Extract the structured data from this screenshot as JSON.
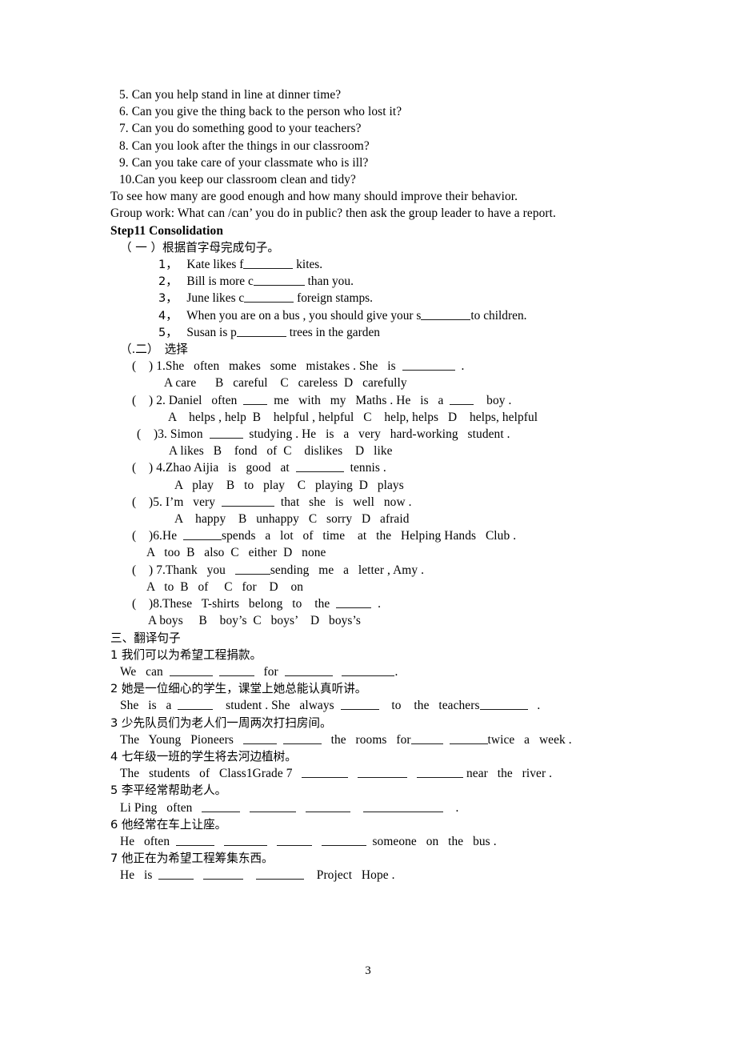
{
  "document": {
    "page_number": "3",
    "ink_color": "#000000"
  },
  "questions_can_you": [
    "5. Can you help stand in line at dinner time?",
    "6. Can you give the thing back to the person who lost it?",
    "7. Can you do something good to your teachers?",
    "8. Can you look after the things in our classroom?",
    "9. Can you take care of your classmate who is ill?",
    "10.Can you keep our classroom clean and tidy?"
  ],
  "instructions": {
    "to_see": "To see how many are good enough and how many should improve their behavior.",
    "group_work": "Group work: What can /can’ you do in public? then ask the group leader to have a report."
  },
  "step11": {
    "heading": "Step11 Consolidation",
    "section_one": {
      "label": "（ 一 ）根据首字母完成句子。",
      "items": [
        {
          "num": "1，",
          "before": "Kate likes f",
          "blank": 62,
          "after": " kites."
        },
        {
          "num": "2，",
          "before": "Bill is more c",
          "blank": 64,
          "after": " than you."
        },
        {
          "num": "3，",
          "before": "June likes c",
          "blank": 62,
          "after": " foreign stamps."
        },
        {
          "num": "4，",
          "before": "When you are on a bus , you should give your s",
          "blank": 62,
          "after": "to children."
        },
        {
          "num": "5，",
          "before": "Susan is p",
          "blank": 62,
          "after": " trees in the garden"
        }
      ]
    },
    "section_two": {
      "label": "（.二）　选择",
      "items": [
        {
          "stem_parts": [
            "(    ) 1.She   often   makes   some   mistakes . She   is  ",
            "  ."
          ],
          "blank": 66,
          "options": "A care      B   careful    C   careless  D   carefully"
        },
        {
          "stem_parts": [
            "(    ) 2. Daniel   often  ",
            "  me   with   my   Maths . He   is   a  ",
            "    boy ."
          ],
          "blank": 30,
          "blank2": 30,
          "options": "A    helps , help  B    helpful , helpful   C    help, helps   D    helps, helpful"
        },
        {
          "stem_parts": [
            "(    )3. Simon  ",
            "  studying . He   is   a   very   hard-working   student ."
          ],
          "blank": 42,
          "options": "A likes   B    fond   of  C    dislikes    D   like"
        },
        {
          "stem_parts": [
            "(    ) 4.Zhao Aijia   is   good   at  ",
            "  tennis ."
          ],
          "blank": 60,
          "options": "A   play    B   to   play    C   playing  D   plays"
        },
        {
          "stem_parts": [
            "(    )5. I’m   very  ",
            "  that   she   is   well   now ."
          ],
          "blank": 66,
          "options": "A    happy    B   unhappy   C   sorry   D   afraid"
        },
        {
          "stem_parts": [
            "(    )6.He  ",
            "spends   a   lot   of   time    at   the   Helping Hands   Club ."
          ],
          "blank": 48,
          "options": "A   too  B   also  C   either  D   none"
        },
        {
          "stem_parts": [
            "(    ) 7.Thank   you   ",
            "sending   me   a   letter , Amy ."
          ],
          "blank": 44,
          "options": "A   to  B   of     C   for    D    on"
        },
        {
          "stem_parts": [
            "(    )8.These   T-shirts   belong   to    the  ",
            "  ."
          ],
          "blank": 44,
          "options": "A boys     B    boy’s  C   boys’    D   boys’s"
        }
      ]
    }
  },
  "translation": {
    "heading": "三、翻译句子",
    "items": [
      {
        "cn": "1 我们可以为希望工程捐款。",
        "en_parts": [
          "We   can  ",
          "  ",
          "   for  ",
          "   ",
          "."
        ],
        "blanks": [
          54,
          44,
          60,
          66
        ]
      },
      {
        "cn": "2 她是一位细心的学生，课堂上她总能认真听讲。",
        "en_parts": [
          "She   is   a  ",
          "    student . She   always  ",
          "    to    the   teachers",
          "   ."
        ],
        "blanks": [
          44,
          48,
          60
        ]
      },
      {
        "cn": "3 少先队员们为老人们一周两次打扫房间。",
        "en_parts": [
          "The   Young   Pioneers   ",
          "  ",
          "   the   rooms   for",
          "  ",
          "twice   a   week ."
        ],
        "blanks": [
          42,
          48,
          40,
          48
        ]
      },
      {
        "cn": "4 七年级一班的学生将去河边植树。",
        "en_parts": [
          "The   students   of   Class1Grade 7   ",
          "   ",
          "   ",
          " near   the   river ."
        ],
        "blanks": [
          58,
          62,
          58
        ]
      },
      {
        "cn": "5 李平经常帮助老人。",
        "en_parts": [
          "Li Ping   often   ",
          "   ",
          "   ",
          "    ",
          "    ."
        ],
        "blanks": [
          48,
          58,
          56,
          100
        ]
      },
      {
        "cn": "6 他经常在车上让座。",
        "en_parts": [
          "He   often  ",
          "   ",
          "   ",
          "   ",
          "  someone   on   the   bus ."
        ],
        "blanks": [
          48,
          54,
          44,
          56
        ]
      },
      {
        "cn": "7 他正在为希望工程筹集东西。",
        "en_parts": [
          "He   is  ",
          "   ",
          "    ",
          "    Project   Hope ."
        ],
        "blanks": [
          44,
          50,
          60
        ]
      }
    ]
  }
}
